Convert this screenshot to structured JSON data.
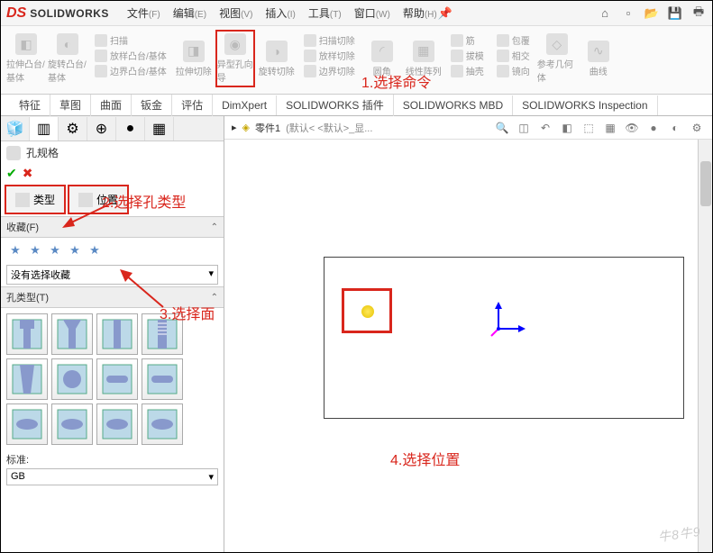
{
  "title": {
    "brand": "SOLIDWORKS"
  },
  "menus": [
    {
      "label": "文件",
      "key": "(F)"
    },
    {
      "label": "编辑",
      "key": "(E)"
    },
    {
      "label": "视图",
      "key": "(V)"
    },
    {
      "label": "插入",
      "key": "(I)"
    },
    {
      "label": "工具",
      "key": "(T)"
    },
    {
      "label": "窗口",
      "key": "(W)"
    },
    {
      "label": "帮助",
      "key": "(H)"
    }
  ],
  "ribbon": {
    "items": {
      "extrude_boss": "拉伸凸台/基体",
      "revolve_boss": "旋转凸台/基体",
      "sweep": "扫描",
      "loft": "放样凸台/基体",
      "boundary": "边界凸台/基体",
      "extrude_cut": "拉伸切除",
      "hole_wizard": "异型孔向导",
      "revolve_cut": "旋转切除",
      "sweep_cut": "扫描切除",
      "loft_cut": "放样切除",
      "boundary_cut": "边界切除",
      "fillet": "圆角",
      "pattern": "线性阵列",
      "rib": "筋",
      "draft": "拔模",
      "shell": "抽壳",
      "wrap": "包覆",
      "intersect": "相交",
      "mirror": "镜向",
      "ref_geom": "参考几何体",
      "curves": "曲线"
    }
  },
  "tabs": [
    "特征",
    "草图",
    "曲面",
    "钣金",
    "评估",
    "DimXpert",
    "SOLIDWORKS 插件",
    "SOLIDWORKS MBD",
    "SOLIDWORKS Inspection"
  ],
  "panel": {
    "title": "孔规格",
    "type_tab": "类型",
    "position_tab": "位置",
    "favorites_hdr": "收藏(F)",
    "favorites_sel": "没有选择收藏",
    "hole_type_hdr": "孔类型(T)",
    "standard_label": "标准:",
    "standard_value": "GB"
  },
  "document": {
    "name": "零件1",
    "config": "(默认< <默认>_显..."
  },
  "annotations": {
    "a1": "1.选择命令",
    "a2": "2.选择孔类型",
    "a3": "3.选择面",
    "a4": "4.选择位置"
  },
  "watermark": "牛8牛9"
}
